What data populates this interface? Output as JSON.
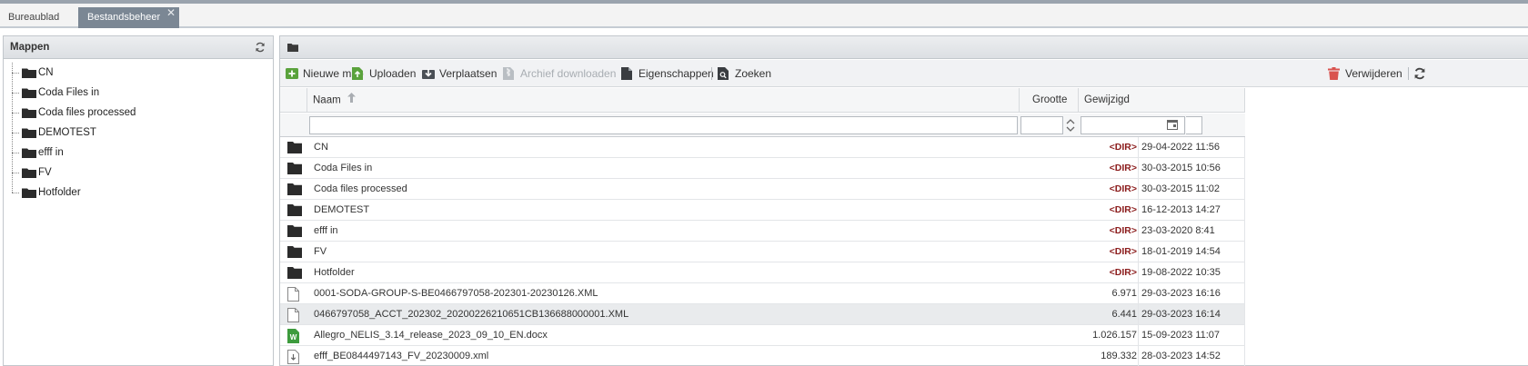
{
  "tabs": [
    {
      "label": "Bureaublad",
      "active": false
    },
    {
      "label": "Bestandsbeheer",
      "active": true
    }
  ],
  "tab_close": "✕",
  "left_panel": {
    "title": "Mappen",
    "folders": [
      "CN",
      "Coda Files in",
      "Coda files processed",
      "DEMOTEST",
      "efff in",
      "FV",
      "Hotfolder"
    ]
  },
  "toolbar": {
    "new_folder": "Nieuwe map",
    "upload": "Uploaden",
    "move": "Verplaatsen",
    "archive_download": "Archief downloaden",
    "properties": "Eigenschappen",
    "search": "Zoeken",
    "delete": "Verwijderen"
  },
  "grid": {
    "columns": {
      "name": "Naam",
      "size": "Grootte",
      "modified": "Gewijzigd"
    },
    "sort": {
      "column": "name",
      "direction": "ascending"
    },
    "rows": [
      {
        "type": "folder",
        "name": "CN",
        "size": "<DIR>",
        "modified": "29-04-2022 11:56"
      },
      {
        "type": "folder",
        "name": "Coda Files in",
        "size": "<DIR>",
        "modified": "30-03-2015 10:56"
      },
      {
        "type": "folder",
        "name": "Coda files processed",
        "size": "<DIR>",
        "modified": "30-03-2015 11:02"
      },
      {
        "type": "folder",
        "name": "DEMOTEST",
        "size": "<DIR>",
        "modified": "16-12-2013 14:27"
      },
      {
        "type": "folder",
        "name": "efff in",
        "size": "<DIR>",
        "modified": "23-03-2020 8:41"
      },
      {
        "type": "folder",
        "name": "FV",
        "size": "<DIR>",
        "modified": "18-01-2019 14:54"
      },
      {
        "type": "folder",
        "name": "Hotfolder",
        "size": "<DIR>",
        "modified": "19-08-2022 10:35"
      },
      {
        "type": "file",
        "name": "0001-SODA-GROUP-S-BE0466797058-202301-20230126.XML",
        "size": "6.971",
        "modified": "29-03-2023 16:16"
      },
      {
        "type": "file",
        "name": "0466797058_ACCT_202302_20200226210651CB136688000001.XML",
        "size": "6.441",
        "modified": "29-03-2023 16:14",
        "selected": true
      },
      {
        "type": "word",
        "name": "Allegro_NELIS_3.14_release_2023_09_10_EN.docx",
        "size": "1.026.157",
        "modified": "15-09-2023 11:07"
      },
      {
        "type": "xml",
        "name": "efff_BE0844497143_FV_20230009.xml",
        "size": "189.332",
        "modified": "28-03-2023 14:52"
      }
    ]
  },
  "colors": {
    "active_tab": "#7b8794",
    "dir_label": "#8b1c1c",
    "add_green": "#5aa23c",
    "delete_red": "#d9534f"
  }
}
